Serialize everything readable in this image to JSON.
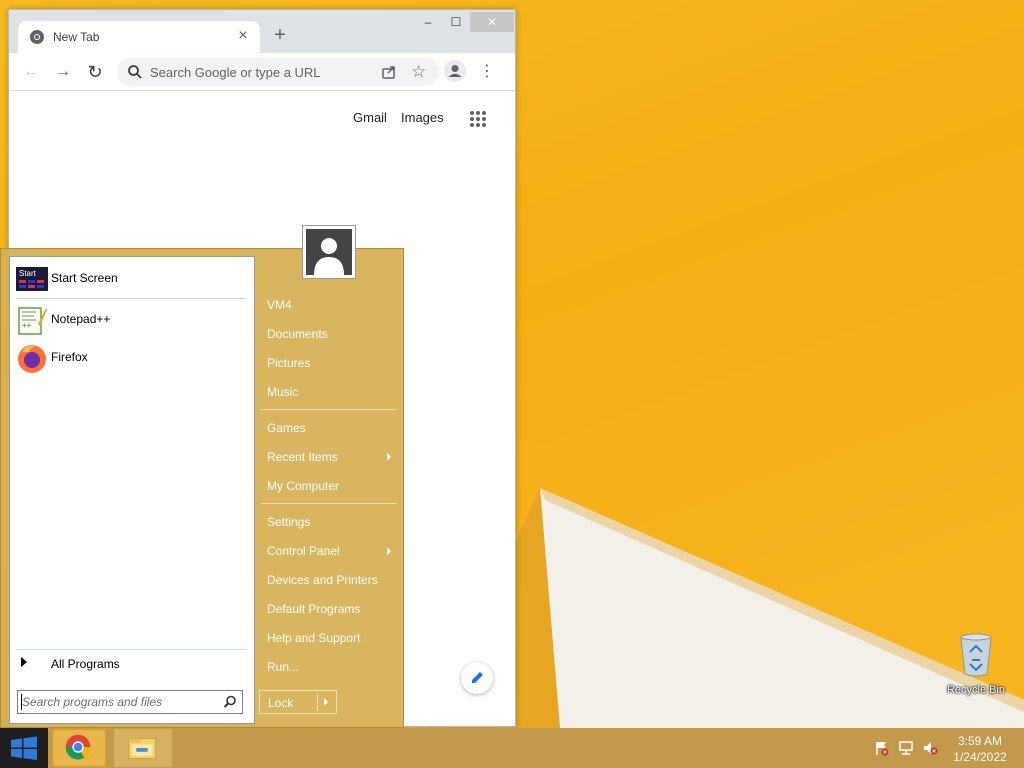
{
  "browser": {
    "tab_title": "New Tab",
    "tab_close": "×",
    "new_tab": "+",
    "window_controls": {
      "minimize": "–",
      "maximize": "☐",
      "close": "✕"
    },
    "nav": {
      "back": "←",
      "forward": "→",
      "reload": "↻"
    },
    "omnibox_placeholder": "Search Google or type a URL",
    "menu": "⋮",
    "ntp": {
      "gmail": "Gmail",
      "images": "Images"
    }
  },
  "start_menu": {
    "programs": [
      {
        "label": "Start Screen",
        "icon": "start-screen-icon"
      },
      {
        "label": "Notepad++",
        "icon": "notepadpp-icon"
      },
      {
        "label": "Firefox",
        "icon": "firefox-icon"
      }
    ],
    "all_programs": "All Programs",
    "search_placeholder": "Search programs and files",
    "right_items": [
      {
        "label": "VM4",
        "submenu": false
      },
      {
        "label": "Documents",
        "submenu": false
      },
      {
        "label": "Pictures",
        "submenu": false
      },
      {
        "label": "Music",
        "submenu": false
      },
      {
        "label": "Games",
        "submenu": false
      },
      {
        "label": "Recent Items",
        "submenu": true
      },
      {
        "label": "My Computer",
        "submenu": false
      },
      {
        "label": "Settings",
        "submenu": false
      },
      {
        "label": "Control Panel",
        "submenu": true
      },
      {
        "label": "Devices and Printers",
        "submenu": false
      },
      {
        "label": "Default Programs",
        "submenu": false
      },
      {
        "label": "Help and Support",
        "submenu": false
      },
      {
        "label": "Run...",
        "submenu": false
      }
    ],
    "lock": "Lock"
  },
  "desktop": {
    "recycle_bin": "Recycle Bin"
  },
  "taskbar": {
    "time": "3:59 AM",
    "date": "1/24/2022"
  },
  "colors": {
    "wallpaper": "#f5ad14",
    "start_menu_bg": "#d6af54",
    "taskbar": "#c39a4c"
  }
}
